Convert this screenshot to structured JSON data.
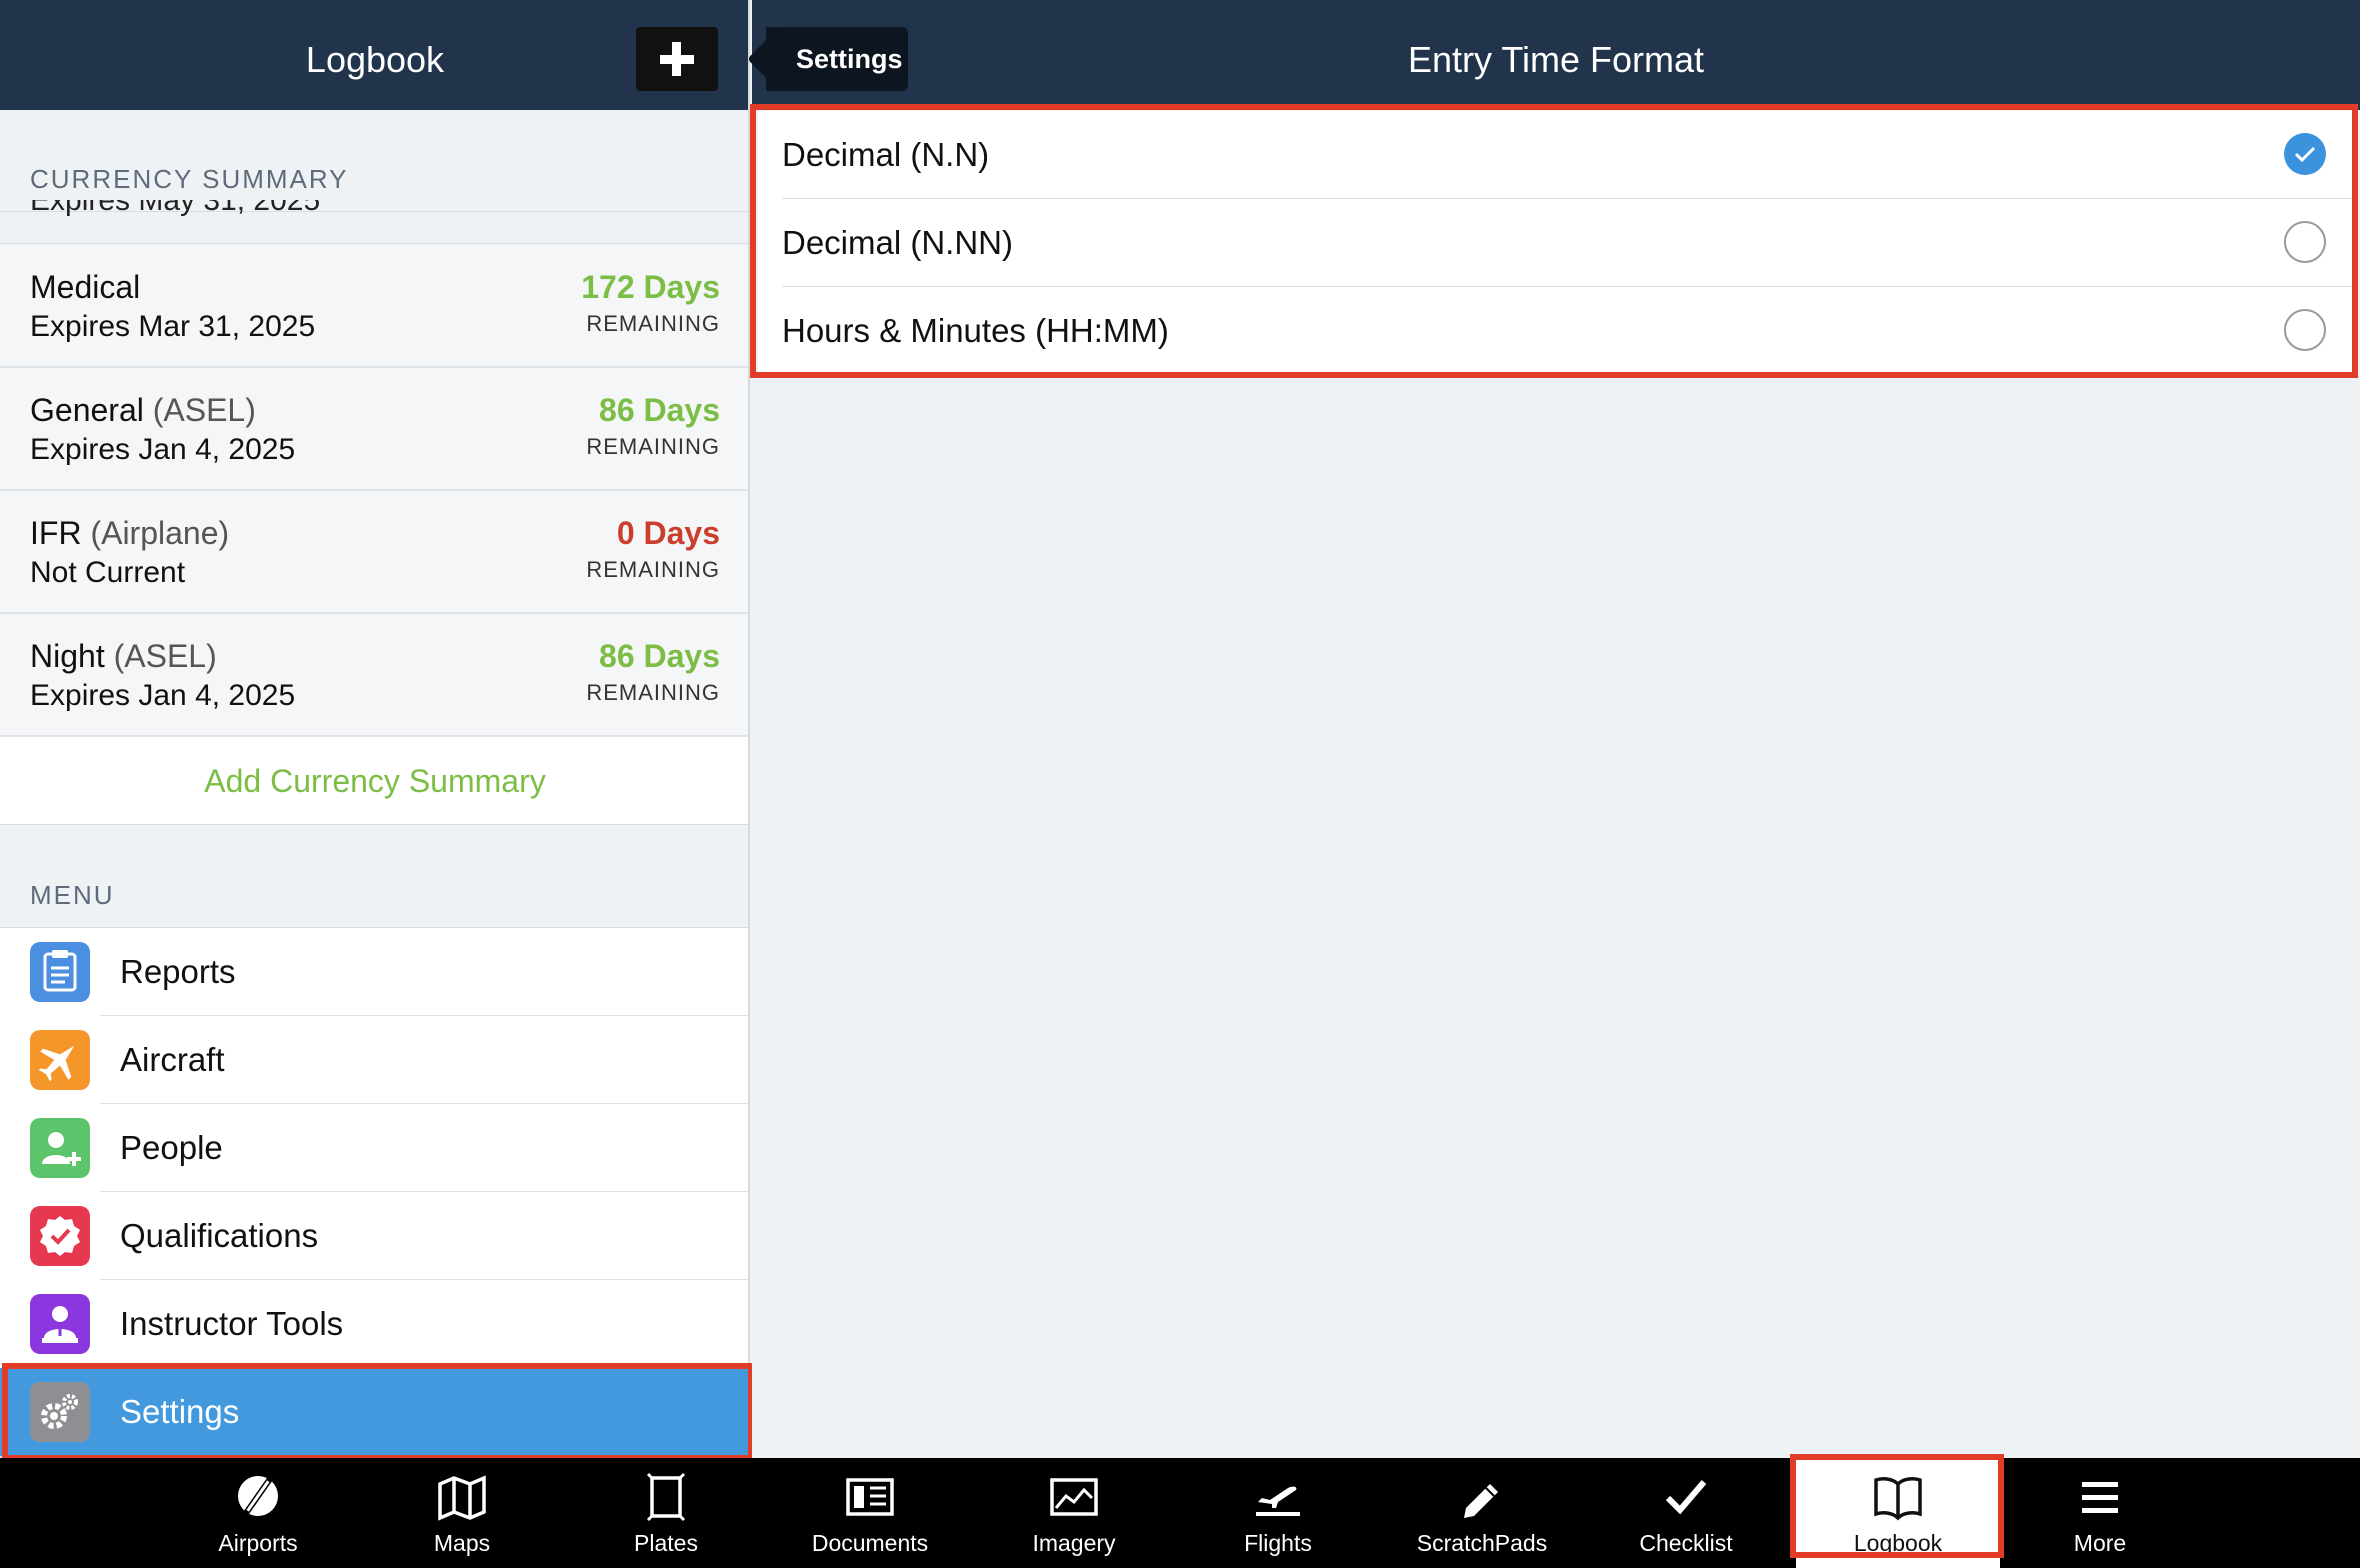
{
  "left_panel": {
    "title": "Logbook",
    "currency_header": "CURRENCY SUMMARY",
    "clipped_row_text": "Expires May 31, 2025",
    "currency": [
      {
        "title": "Medical",
        "subtitle": "",
        "expires": "Expires Mar 31, 2025",
        "days": "172 Days",
        "remaining": "REMAINING",
        "status_color": "#7cbe45"
      },
      {
        "title": "General",
        "subtitle": "(ASEL)",
        "expires": "Expires Jan 4, 2025",
        "days": "86 Days",
        "remaining": "REMAINING",
        "status_color": "#7cbe45"
      },
      {
        "title": "IFR",
        "subtitle": "(Airplane)",
        "expires": "Not Current",
        "days": "0 Days",
        "remaining": "REMAINING",
        "status_color": "#cc3e2c"
      },
      {
        "title": "Night",
        "subtitle": "(ASEL)",
        "expires": "Expires Jan 4, 2025",
        "days": "86 Days",
        "remaining": "REMAINING",
        "status_color": "#7cbe45"
      }
    ],
    "add_currency_label": "Add Currency Summary",
    "menu_header": "MENU",
    "menu": [
      {
        "label": "Reports",
        "icon": "report-icon",
        "color": "#4a8fe0"
      },
      {
        "label": "Aircraft",
        "icon": "airplane-icon",
        "color": "#f5962a"
      },
      {
        "label": "People",
        "icon": "add-person-icon",
        "color": "#5cc46a"
      },
      {
        "label": "Qualifications",
        "icon": "qualification-badge-icon",
        "color": "#e6384f"
      },
      {
        "label": "Instructor Tools",
        "icon": "instructor-icon",
        "color": "#8a37e0"
      },
      {
        "label": "Settings",
        "icon": "gears-icon",
        "color": "#8e8e93"
      }
    ]
  },
  "right_panel": {
    "back_label": "Settings",
    "title": "Entry Time Format",
    "options": [
      {
        "label": "Decimal (N.N)",
        "selected": true
      },
      {
        "label": "Decimal (N.NN)",
        "selected": false
      },
      {
        "label": "Hours & Minutes (HH:MM)",
        "selected": false
      }
    ]
  },
  "tab_bar": {
    "active": "Logbook",
    "tabs": [
      {
        "label": "Airports",
        "icon": "airport-icon"
      },
      {
        "label": "Maps",
        "icon": "map-icon"
      },
      {
        "label": "Plates",
        "icon": "plate-icon"
      },
      {
        "label": "Documents",
        "icon": "documents-icon"
      },
      {
        "label": "Imagery",
        "icon": "imagery-icon"
      },
      {
        "label": "Flights",
        "icon": "flight-takeoff-icon"
      },
      {
        "label": "ScratchPads",
        "icon": "pencil-icon"
      },
      {
        "label": "Checklist",
        "icon": "checkmark-icon"
      },
      {
        "label": "Logbook",
        "icon": "open-book-icon"
      },
      {
        "label": "More",
        "icon": "menu-icon"
      }
    ]
  },
  "colors": {
    "nav_bar": "#22334c",
    "accent_green": "#7cbe45",
    "alert_red": "#cc3e2c",
    "selection_blue": "#4399dd",
    "highlight_red": "#e23c29"
  }
}
